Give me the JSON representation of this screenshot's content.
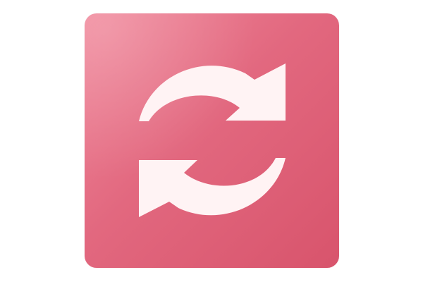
{
  "app_icon": {
    "icon": "sync-arrows-icon",
    "colors": {
      "tile_light": "#f0879a",
      "tile_mid": "#e2687f",
      "tile_dark": "#d8546c",
      "glyph": "#fff3f4"
    }
  }
}
